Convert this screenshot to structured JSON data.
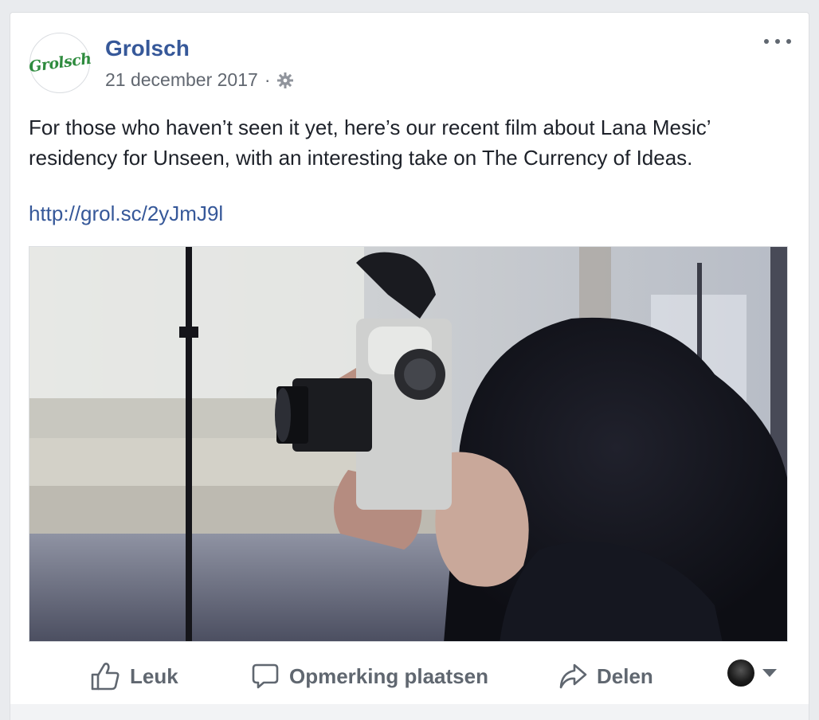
{
  "post": {
    "author": "Grolsch",
    "avatar_text": "Grolsch",
    "date": "21 december 2017",
    "separator": "·",
    "audience_icon": "globe-settings-icon",
    "more_icon": "ellipsis-icon",
    "text": "For those who haven’t seen it yet, here’s our recent film about Lana Mesic’ residency for Unseen, with an interesting take on The Currency of Ideas.",
    "link": "http://grol.sc/2yJmJ9l",
    "media_description_icon": "video-thumbnail"
  },
  "actions": {
    "like": {
      "label": "Leuk",
      "icon": "thumbs-up-icon"
    },
    "comment": {
      "label": "Opmerking plaatsen",
      "icon": "speech-bubble-icon"
    },
    "share": {
      "label": "Delen",
      "icon": "share-arrow-icon"
    },
    "profile_picker_icon": "chevron-down-icon"
  },
  "colors": {
    "link": "#365899",
    "text": "#1d2129",
    "muted": "#616770",
    "background": "#e9ebee",
    "brand_green": "#2e8b3e"
  }
}
